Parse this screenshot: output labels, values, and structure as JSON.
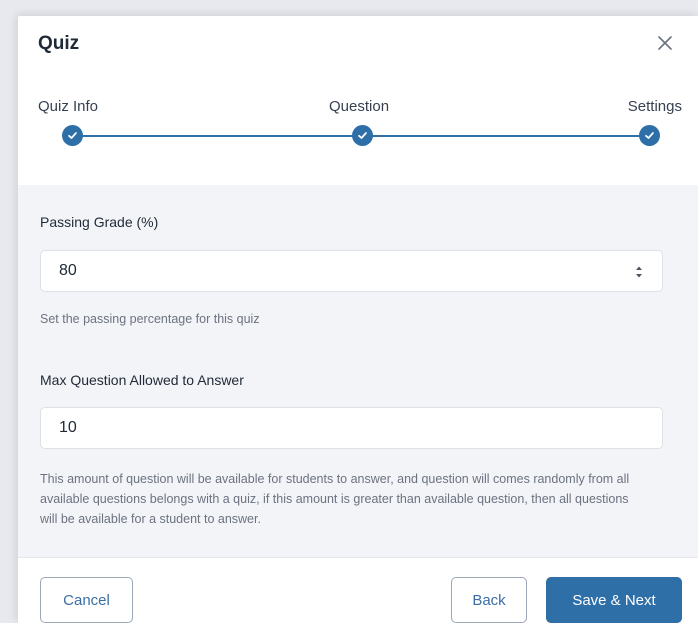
{
  "modal": {
    "title": "Quiz"
  },
  "stepper": {
    "steps": [
      {
        "label": "Quiz Info",
        "status": "completed"
      },
      {
        "label": "Question",
        "status": "completed"
      },
      {
        "label": "Settings",
        "status": "completed"
      }
    ]
  },
  "form": {
    "passing_grade": {
      "label": "Passing Grade (%)",
      "value": "80",
      "help": "Set the passing percentage for this quiz"
    },
    "max_questions": {
      "label": "Max Question Allowed to Answer",
      "value": "10",
      "help": "This amount of question will be available for students to answer, and question will comes randomly from all available questions belongs with a quiz, if this amount is greater than available question, then all questions will be available for a student to answer."
    }
  },
  "footer": {
    "cancel_label": "Cancel",
    "back_label": "Back",
    "next_label": "Save & Next"
  },
  "colors": {
    "accent": "#2e6fa7",
    "background": "#f3f4f7"
  },
  "icons": {
    "close": "close-icon",
    "check": "check-icon",
    "spinner": "number-spinner-icon"
  }
}
